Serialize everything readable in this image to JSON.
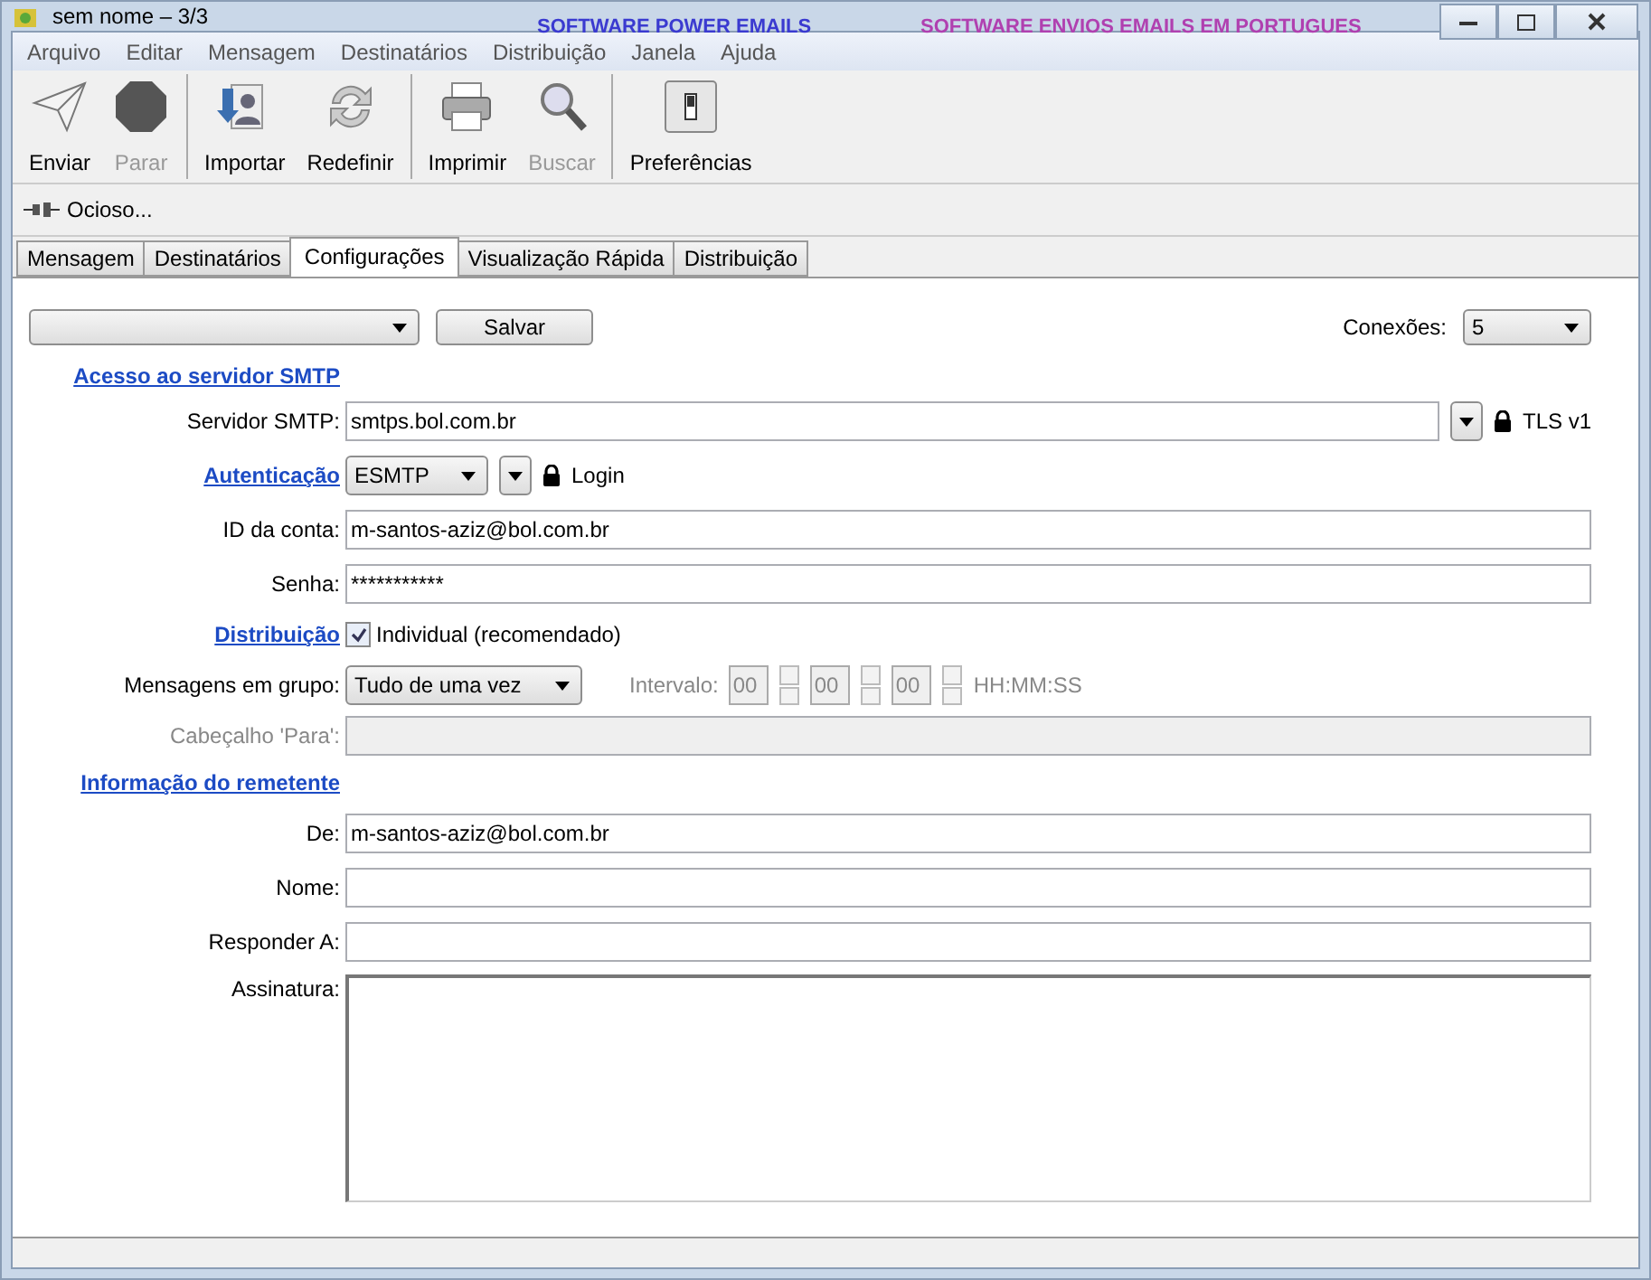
{
  "window": {
    "title": "sem nome – 3/3",
    "banners": [
      {
        "text": "SOFTWARE POWER EMAILS",
        "color": "#3a3ad0"
      },
      {
        "text": "SOFTWARE ENVIOS EMAILS EM PORTUGUES",
        "color": "#b040b0"
      }
    ]
  },
  "menu": [
    "Arquivo",
    "Editar",
    "Mensagem",
    "Destinatários",
    "Distribuição",
    "Janela",
    "Ajuda"
  ],
  "toolbar": [
    [
      {
        "kind": "send",
        "label": "Enviar",
        "disabled": false
      },
      {
        "kind": "stop",
        "label": "Parar",
        "disabled": true
      }
    ],
    [
      {
        "kind": "import",
        "label": "Importar",
        "disabled": false
      },
      {
        "kind": "reset",
        "label": "Redefinir",
        "disabled": false
      }
    ],
    [
      {
        "kind": "print",
        "label": "Imprimir",
        "disabled": false
      },
      {
        "kind": "search",
        "label": "Buscar",
        "disabled": true
      }
    ],
    [
      {
        "kind": "prefs",
        "label": "Preferências",
        "disabled": false
      }
    ]
  ],
  "status": "Ocioso...",
  "tabs": [
    {
      "label": "Mensagem",
      "selected": false
    },
    {
      "label": "Destinatários",
      "selected": false
    },
    {
      "label": "Configurações",
      "selected": true
    },
    {
      "label": "Visualização Rápida",
      "selected": false
    },
    {
      "label": "Distribuição",
      "selected": false
    }
  ],
  "top": {
    "save": "Salvar",
    "connections_label": "Conexões:",
    "connections": "5"
  },
  "smtp": {
    "heading": "Acesso ao servidor SMTP",
    "label": "Servidor SMTP:",
    "value": "smtps.bol.com.br",
    "security": "TLS v1"
  },
  "auth": {
    "heading": "Autenticação",
    "value": "ESMTP",
    "method": "Login"
  },
  "account": [
    {
      "label": "ID da conta:",
      "value": "m-santos-aziz@bol.com.br"
    },
    {
      "label": "Senha:",
      "value": "***********"
    }
  ],
  "distribution": {
    "heading": "Distribuição",
    "label": "Individual (recomendado)",
    "checked": true
  },
  "group": {
    "label": "Mensagens em grupo:",
    "value": "Tudo de uma vez",
    "interval_label": "Intervalo:",
    "spinners": [
      "00",
      "00",
      "00"
    ],
    "format": "HH:MM:SS",
    "disabled": true
  },
  "to_header": {
    "label": "Cabeçalho 'Para':",
    "disabled": true
  },
  "sender": {
    "heading": "Informação do remetente",
    "fields": [
      {
        "label": "De:",
        "value": "m-santos-aziz@bol.com.br"
      },
      {
        "label": "Nome:"
      },
      {
        "label": "Responder A:"
      }
    ],
    "signature_label": "Assinatura:"
  }
}
